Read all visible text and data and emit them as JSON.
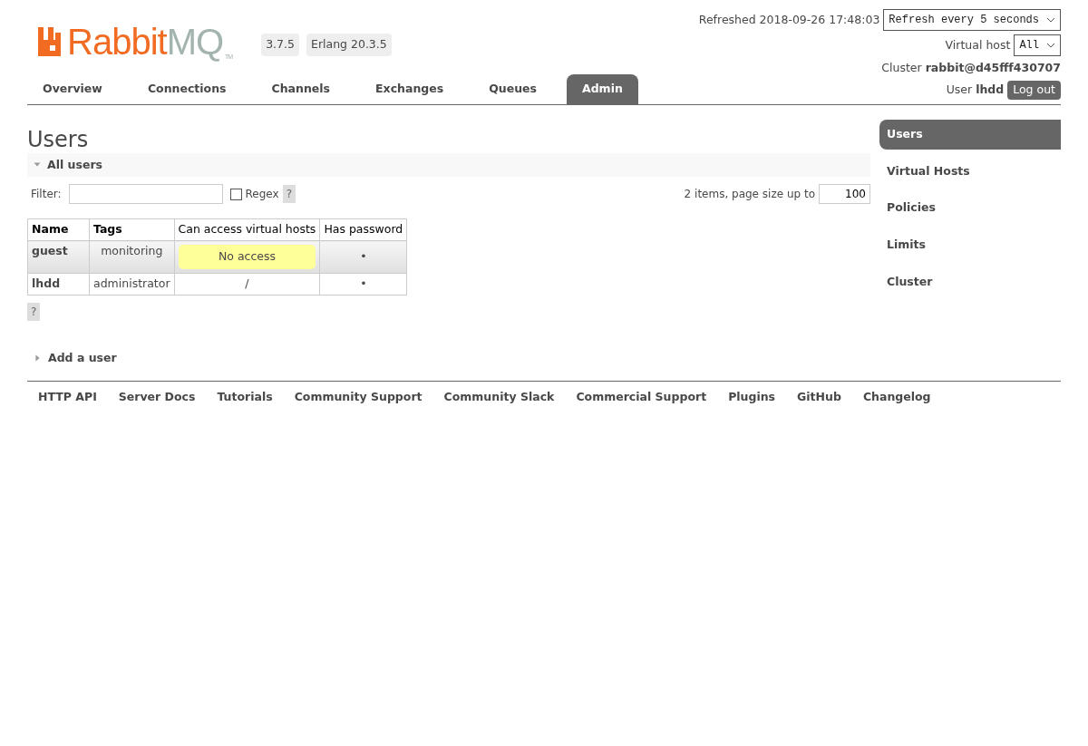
{
  "logo": {
    "brand": "Rabbit",
    "suffix": "MQ",
    "trademark": "TM"
  },
  "versions": [
    "3.7.5",
    "Erlang 20.3.5"
  ],
  "status": {
    "refreshed": "Refreshed 2018-09-26 17:48:03",
    "refresh_select": "Refresh every 5 seconds",
    "vhost_label": "Virtual host",
    "vhost_select": "All",
    "cluster_label": "Cluster",
    "cluster": "rabbit@d45fff430707",
    "user_label": "User",
    "user": "lhdd",
    "logout": "Log out"
  },
  "tabs": [
    {
      "label": "Overview",
      "selected": false
    },
    {
      "label": "Connections",
      "selected": false
    },
    {
      "label": "Channels",
      "selected": false
    },
    {
      "label": "Exchanges",
      "selected": false
    },
    {
      "label": "Queues",
      "selected": false
    },
    {
      "label": "Admin",
      "selected": true
    }
  ],
  "page_title": "Users",
  "section": {
    "title": "All users",
    "expanded": true
  },
  "filter": {
    "label": "Filter:",
    "regex_label": "Regex",
    "regex_checked": false,
    "help": "?",
    "count_text": "2 items, page size up to",
    "page_size": "100"
  },
  "table": {
    "columns": [
      "Name",
      "Tags",
      "Can access virtual hosts",
      "Has password"
    ],
    "rows": [
      {
        "name": "guest",
        "tags": "monitoring",
        "vhosts": "No access",
        "kind": "warning",
        "password": "•"
      },
      {
        "name": "lhdd",
        "tags": "administrator",
        "vhosts": "/",
        "kind": "plain",
        "password": "•"
      }
    ]
  },
  "table_help": "?",
  "add_section": {
    "title": "Add a user",
    "expanded": false
  },
  "sidebar": {
    "items": [
      {
        "label": "Users",
        "selected": true
      },
      {
        "label": "Virtual Hosts",
        "selected": false
      },
      {
        "label": "Policies",
        "selected": false
      },
      {
        "label": "Limits",
        "selected": false
      },
      {
        "label": "Cluster",
        "selected": false
      }
    ]
  },
  "footer": [
    "HTTP API",
    "Server Docs",
    "Tutorials",
    "Community Support",
    "Community Slack",
    "Commercial Support",
    "Plugins",
    "GitHub",
    "Changelog"
  ]
}
